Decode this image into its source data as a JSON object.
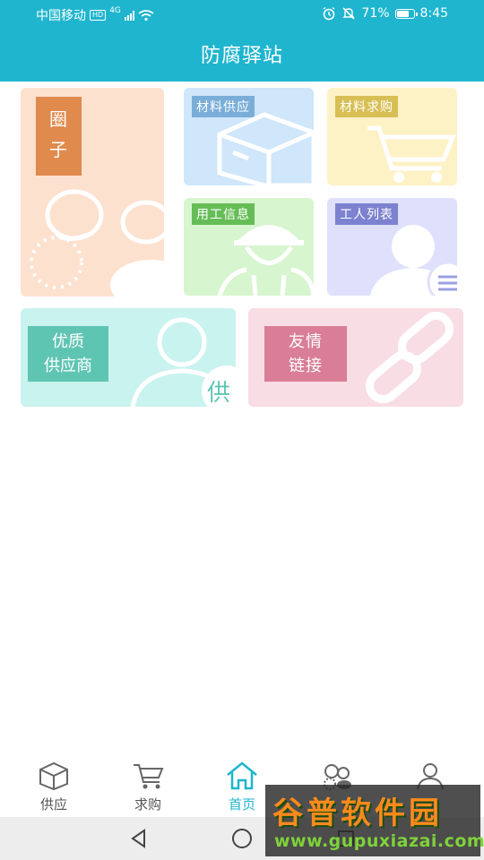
{
  "status_bar": {
    "carrier": "中国移动",
    "hd": "HD",
    "signal_type": "4G",
    "battery": "71%",
    "time": "8:45"
  },
  "header": {
    "title": "防腐驿站"
  },
  "tiles": {
    "circle": {
      "label_line1": "圈",
      "label_line2": "子",
      "color": "#fde1cf",
      "tag_color": "#e08a4d"
    },
    "material_supply": {
      "label": "材料供应",
      "color": "#cfe6fb",
      "tag_color": "#7aaed8"
    },
    "material_purchase": {
      "label": "材料求购",
      "color": "#fdf1c6",
      "tag_color": "#d8bf55"
    },
    "labor_info": {
      "label": "用工信息",
      "color": "#d7f5cf",
      "tag_color": "#66bd57"
    },
    "worker_list": {
      "label": "工人列表",
      "color": "#dfe0fb",
      "tag_color": "#7c82d0"
    },
    "quality_supplier": {
      "label_line1": "优质",
      "label_line2": "供应商",
      "badge": "供",
      "color": "#c9f3ee",
      "tag_color": "#5fc5b3"
    },
    "friend_links": {
      "label_line1": "友情",
      "label_line2": "链接",
      "color": "#f8dde4",
      "tag_color": "#d97e96"
    }
  },
  "bottom_nav": {
    "items": [
      {
        "label": "供应",
        "icon": "box-icon"
      },
      {
        "label": "求购",
        "icon": "cart-icon"
      },
      {
        "label": "首页",
        "icon": "home-icon",
        "active": true
      },
      {
        "label": "",
        "icon": "circle-icon"
      },
      {
        "label": "",
        "icon": "profile-icon"
      }
    ]
  },
  "watermark": {
    "main": "谷普软件园",
    "sub": "www.gupuxiazai.com"
  },
  "colors": {
    "primary": "#1fb5cf"
  }
}
